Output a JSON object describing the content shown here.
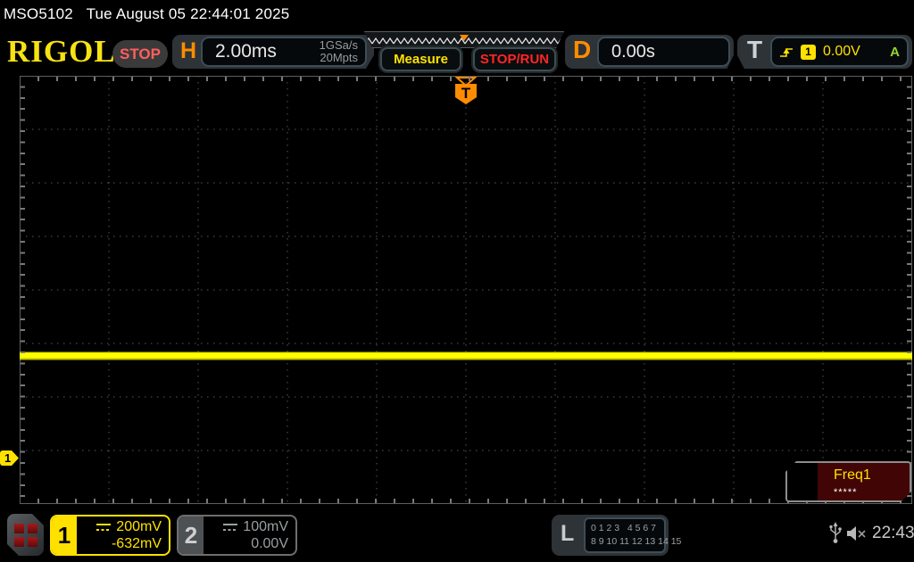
{
  "titlebar": {
    "model": "MSO5102",
    "datetime": "Tue August 05 22:44:01 2025"
  },
  "header": {
    "logo": "RIGOL",
    "run_state": "STOP",
    "horizontal": {
      "label": "H",
      "timebase": "2.00ms",
      "sample_rate": "1GSa/s",
      "mem_depth": "20Mpts"
    },
    "measure_label": "Measure",
    "stop_run_label": "STOP/RUN",
    "delay": {
      "label": "D",
      "value": "0.00s"
    },
    "trigger": {
      "label": "T",
      "slope_icon": "rising-edge-icon",
      "source_badge": "1",
      "level": "0.00V",
      "mode": "A"
    }
  },
  "display": {
    "trigger_marker": "T",
    "ch1_marker": "1"
  },
  "measurement": {
    "name": "Freq1",
    "value": "*****"
  },
  "channels": [
    {
      "id": "1",
      "coupling_icon": "dc-coupling-icon",
      "scale": "200mV",
      "offset": "-632mV"
    },
    {
      "id": "2",
      "coupling_icon": "dc-coupling-icon",
      "scale": "100mV",
      "offset": "0.00V"
    }
  ],
  "logic": {
    "label": "L",
    "row1": "0 1 2 3   4 5 6 7",
    "row2": "8 9 10 11 12 13 14 15"
  },
  "statusbar": {
    "usb_icon": "usb-icon",
    "mute_icon": "speaker-muted-icon",
    "clock": "22:43"
  },
  "colors": {
    "accent_orange": "#ff8c00",
    "channel1_yellow": "#ffe100",
    "run_red": "#ff2626",
    "auto_green": "#96d62e",
    "trace_yellow": "#ffff00",
    "grid_line": "#585858"
  }
}
